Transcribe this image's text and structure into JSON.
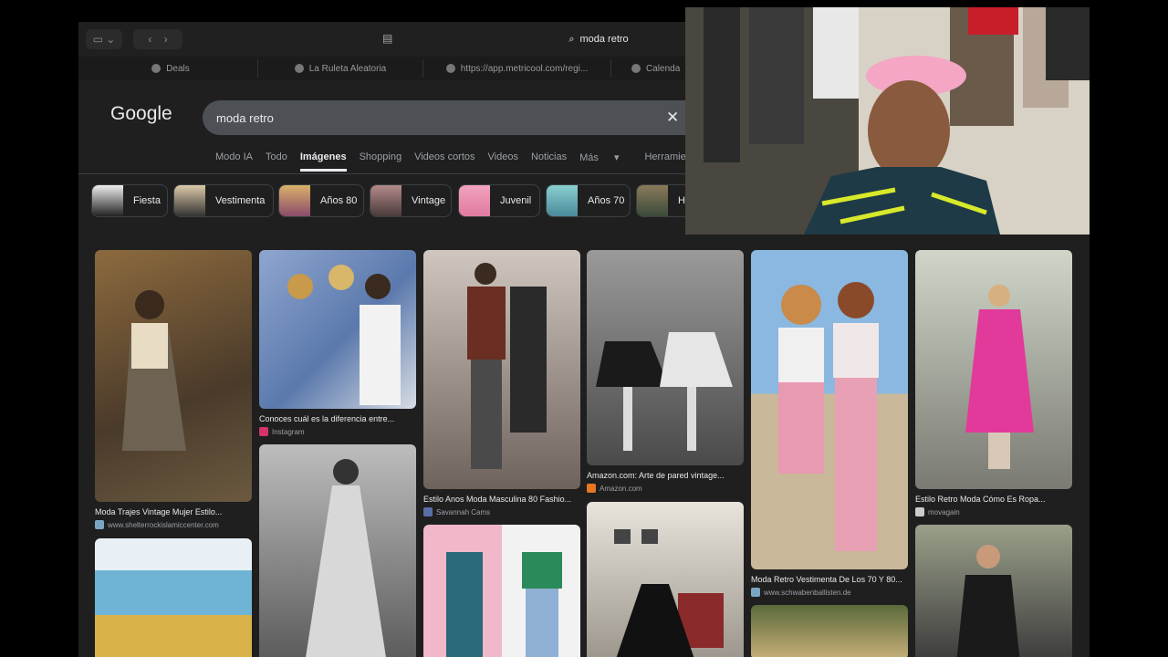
{
  "browser": {
    "address": "moda retro",
    "tabs": [
      {
        "label": "Deals"
      },
      {
        "label": "La Ruleta Aleatoria"
      },
      {
        "label": "https://app.metricool.com/regi..."
      },
      {
        "label": "Calenda"
      }
    ]
  },
  "google": {
    "logo": "Google",
    "query": "moda retro",
    "nav": [
      "Modo IA",
      "Todo",
      "Imágenes",
      "Shopping",
      "Videos cortos",
      "Videos",
      "Noticias",
      "Más",
      "Herramien"
    ],
    "chips": [
      "Fiesta",
      "Vestimenta",
      "Años 80",
      "Vintage",
      "Juvenil",
      "Años 70",
      "Ho"
    ]
  },
  "results": [
    {
      "caption": "Moda Trajes Vintage Mujer Estilo...",
      "source": "www.shelterrockislamiccenter.com",
      "color": "#6b5a40",
      "icon_color": "#7aa6c2"
    },
    {
      "caption": "Conoces cuál es la diferencia entre...",
      "source": "Instagram",
      "color": "#7a8fb5",
      "icon_color": "#d6336c"
    },
    {
      "caption": "Estilo Anos Moda Masculina 80 Fashio...",
      "source": "Savannah Cams",
      "color": "#6e625c",
      "icon_color": "#5a6ea6"
    },
    {
      "caption": "Amazon.com: Arte de pared vintage...",
      "source": "Amazon.com",
      "color": "#6f6f6f",
      "icon_color": "#e87722"
    },
    {
      "caption": "Moda Retro Vestimenta De Los 70 Y 80...",
      "source": "www.schwabenballisten.de",
      "color": "#c9a3a8",
      "icon_color": "#7aa6c2"
    },
    {
      "caption": "Estilo Retro Moda Cómo Es Ropa...",
      "source": "movagain",
      "color": "#a3a89c",
      "icon_color": "#cccccc"
    }
  ],
  "colors": {
    "page_bg": "#1f1f1f",
    "search_bg": "#4d5156",
    "text": "#e8eaed",
    "muted": "#9aa0a6"
  },
  "icons": [
    "sidebar-icon",
    "back-icon",
    "forward-icon",
    "reader-icon",
    "search-icon",
    "close-icon",
    "dropdown-icon"
  ]
}
